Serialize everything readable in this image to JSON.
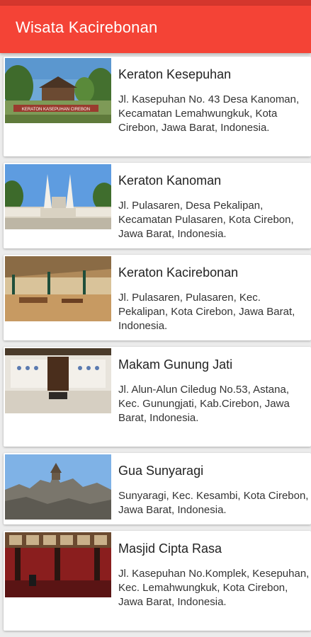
{
  "app": {
    "title": "Wisata Kacirebonan"
  },
  "places": [
    {
      "name": "Keraton Kesepuhan",
      "address": "Jl. Kasepuhan No. 43 Desa Kanoman, Kecamatan Lemahwungkuk, Kota Cirebon, Jawa Barat, Indonesia.",
      "image_icon": "keraton-kesepuhan-photo",
      "image_sign_text": "KERATON KASEPUHAN CIREBON"
    },
    {
      "name": "Keraton Kanoman",
      "address": "Jl. Pulasaren, Desa Pekalipan, Kecamatan Pulasaren, Kota Cirebon, Jawa Barat, Indonesia.",
      "image_icon": "keraton-kanoman-photo"
    },
    {
      "name": "Keraton Kacirebonan",
      "address": "Jl. Pulasaren, Pulasaren, Kec. Pekalipan, Kota Cirebon, Jawa Barat, Indonesia.",
      "image_icon": "keraton-kacirebonan-photo"
    },
    {
      "name": "Makam Gunung Jati",
      "address": "Jl. Alun-Alun Ciledug No.53, Astana, Kec. Gunungjati, Kab.Cirebon, Jawa Barat, Indonesia.",
      "image_icon": "makam-gunung-jati-photo"
    },
    {
      "name": "Gua Sunyaragi",
      "address": "Sunyaragi, Kec. Kesambi, Kota Cirebon, Jawa Barat, Indonesia.",
      "image_icon": "gua-sunyaragi-photo"
    },
    {
      "name": "Masjid Cipta Rasa",
      "address": "Jl. Kasepuhan No.Komplek, Kesepuhan, Kec. Lemahwungkuk, Kota Cirebon, Jawa Barat, Indonesia.",
      "image_icon": "masjid-cipta-rasa-photo"
    }
  ],
  "colors": {
    "app_bar": "#f44336",
    "status_bar": "#d4362d",
    "background": "#ececec",
    "card": "#ffffff"
  }
}
